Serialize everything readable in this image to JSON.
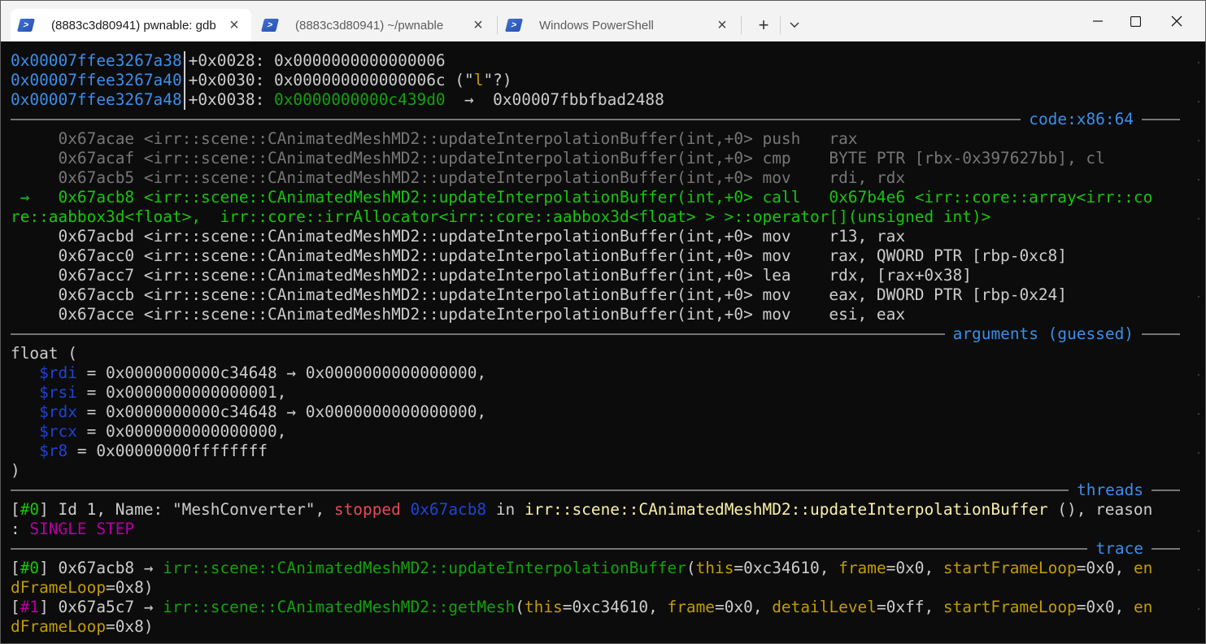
{
  "tabs": [
    {
      "title": "(8883c3d80941) pwnable: gdb",
      "active": true
    },
    {
      "title": "(8883c3d80941) ~/pwnable",
      "active": false
    },
    {
      "title": "Windows PowerShell",
      "active": false
    }
  ],
  "controls": {
    "new_tab": "+",
    "dropdown": "⌄",
    "minimize": "—",
    "maximize": "☐",
    "close": "✕",
    "tab_close": "×"
  },
  "stack": [
    {
      "addr": "0x00007ffee3267a38",
      "offset": "+0x0028: ",
      "value": "0x0000000000000006",
      "extra": ""
    },
    {
      "addr": "0x00007ffee3267a40",
      "offset": "+0x0030: ",
      "value": "0x000000000000006c",
      "extra_pre": " (\"",
      "extra_char": "l",
      "extra_post": "\"?)"
    },
    {
      "addr": "0x00007ffee3267a48",
      "offset": "+0x0038: ",
      "value": "0x0000000000c439d0",
      "arrow": "  →  ",
      "target": "0x00007fbbfbad2488"
    }
  ],
  "sections": {
    "code": "code:x86:64",
    "arguments": "arguments (guessed)",
    "threads": "threads",
    "trace": "trace"
  },
  "code": {
    "prev": [
      "     0x67acae <irr::scene::CAnimatedMeshMD2::updateInterpolationBuffer(int,+0> push   rax",
      "     0x67acaf <irr::scene::CAnimatedMeshMD2::updateInterpolationBuffer(int,+0> cmp    BYTE PTR [rbx-0x397627bb], cl",
      "     0x67acb5 <irr::scene::CAnimatedMeshMD2::updateInterpolationBuffer(int,+0> mov    rdi, rdx"
    ],
    "current_1": " →   0x67acb8 <irr::scene::CAnimatedMeshMD2::updateInterpolationBuffer(int,+0> call   0x67b4e6 <irr::core::array<irr::co",
    "current_2": "re::aabbox3d<float>,  irr::core::irrAllocator<irr::core::aabbox3d<float> > >::operator[](unsigned int)>",
    "next": [
      "     0x67acbd <irr::scene::CAnimatedMeshMD2::updateInterpolationBuffer(int,+0> mov    r13, rax",
      "     0x67acc0 <irr::scene::CAnimatedMeshMD2::updateInterpolationBuffer(int,+0> mov    rax, QWORD PTR [rbp-0xc8]",
      "     0x67acc7 <irr::scene::CAnimatedMeshMD2::updateInterpolationBuffer(int,+0> lea    rdx, [rax+0x38]",
      "     0x67accb <irr::scene::CAnimatedMeshMD2::updateInterpolationBuffer(int,+0> mov    eax, DWORD PTR [rbp-0x24]",
      "     0x67acce <irr::scene::CAnimatedMeshMD2::updateInterpolationBuffer(int,+0> mov    esi, eax"
    ]
  },
  "arguments": {
    "open": "float (",
    "close": ")",
    "regs": [
      {
        "reg": "$rdi",
        "text": " = 0x0000000000c34648 → 0x0000000000000000,"
      },
      {
        "reg": "$rsi",
        "text": " = 0x0000000000000001,"
      },
      {
        "reg": "$rdx",
        "text": " = 0x0000000000c34648 → 0x0000000000000000,"
      },
      {
        "reg": "$rcx",
        "text": " = 0x0000000000000000,"
      },
      {
        "reg": "$r8",
        "text": " = 0x00000000ffffffff"
      }
    ]
  },
  "threads": {
    "lb": "[",
    "idx": "#0",
    "rb": "] Id 1, Name: \"MeshConverter\", ",
    "state": "stopped",
    "addr": " 0x67acb8",
    "in": " in ",
    "func": "irr::scene::CAnimatedMeshMD2::updateInterpolationBuffer",
    "tail": " (), reason",
    "reason_prefix": ": ",
    "reason": "SINGLE STEP"
  },
  "trace": [
    {
      "idx": "#0",
      "addr": "] 0x67acb8 → ",
      "func": "irr::scene::CAnimatedMeshMD2::updateInterpolationBuffer",
      "args1": [
        [
          "this",
          "=0xc34610, "
        ],
        [
          "frame",
          "=0x0, "
        ],
        [
          "startFrameLoop",
          "=0x0, "
        ],
        [
          "en",
          ""
        ]
      ],
      "cont_name": "dFrameLoop",
      "cont_val": "=0x8)"
    },
    {
      "idx": "#1",
      "addr": "] 0x67a5c7 → ",
      "func": "irr::scene::CAnimatedMeshMD2::getMesh",
      "args1": [
        [
          "this",
          "=0xc34610, "
        ],
        [
          "frame",
          "=0x0, "
        ],
        [
          "detailLevel",
          "=0xff, "
        ],
        [
          "startFrameLoop",
          "=0x0, "
        ],
        [
          "en",
          ""
        ]
      ],
      "cont_name": "dFrameLoop",
      "cont_val": "=0x8)"
    }
  ]
}
